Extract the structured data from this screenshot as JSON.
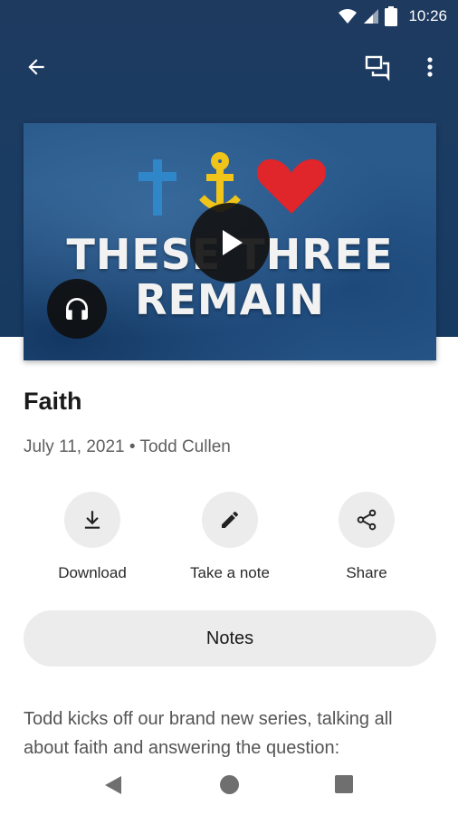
{
  "status": {
    "time": "10:26",
    "icons": [
      "wifi-icon",
      "signal-icon",
      "battery-icon"
    ]
  },
  "app_bar": {
    "icons": [
      "back-arrow-icon",
      "chat-icon",
      "more-vert-icon"
    ]
  },
  "artwork": {
    "line1": "THESE THREE",
    "line2": "REMAIN",
    "symbols": [
      "cross-icon",
      "anchor-icon",
      "heart-icon"
    ],
    "colors": {
      "cross": "#2f86c9",
      "anchor": "#f0c419",
      "heart": "#e0252b",
      "background": "#2a5a8c"
    }
  },
  "sermon": {
    "title": "Faith",
    "meta": "July 11, 2021 • Todd Cullen"
  },
  "actions": [
    {
      "label": "Download",
      "icon": "download-icon"
    },
    {
      "label": "Take a note",
      "icon": "pencil-icon"
    },
    {
      "label": "Share",
      "icon": "share-icon"
    }
  ],
  "notes_button": "Notes",
  "description": "Todd kicks off our brand new series, talking all about faith and answering the question:",
  "nav": {
    "icons": [
      "nav-back-icon",
      "nav-home-icon",
      "nav-recents-icon"
    ]
  },
  "colors": {
    "header": "#1e3a5f",
    "pill": "#ececec"
  }
}
